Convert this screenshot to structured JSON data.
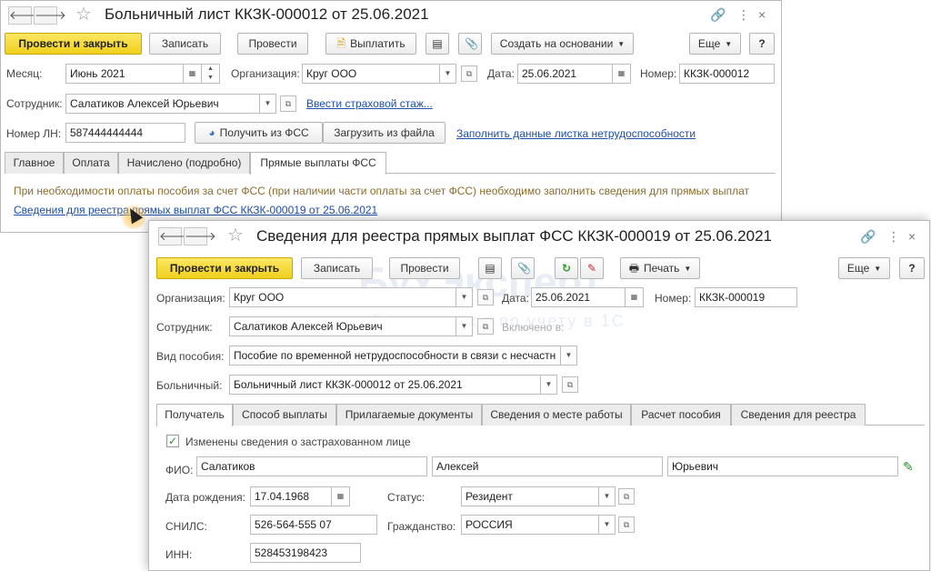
{
  "win1": {
    "title": "Больничный лист ККЗК-000012 от 25.06.2021",
    "nav_back": "🡐",
    "nav_forward": "🡒",
    "toolbar": {
      "post_close": "Провести и закрыть",
      "save": "Записать",
      "post": "Провести",
      "pay": "Выплатить",
      "create_based": "Создать на основании",
      "more": "Еще",
      "help": "?"
    },
    "form": {
      "month_label": "Месяц:",
      "month_value": "Июнь 2021",
      "org_label": "Организация:",
      "org_value": "Круг ООО",
      "date_label": "Дата:",
      "date_value": "25.06.2021",
      "number_label": "Номер:",
      "number_value": "ККЗК-000012",
      "employee_label": "Сотрудник:",
      "employee_value": "Салатиков Алексей Юрьевич",
      "insurance_link": "Ввести страховой стаж...",
      "ln_label": "Номер ЛН:",
      "ln_value": "587444444444",
      "get_fss": "Получить из ФСС",
      "load_file": "Загрузить из файла",
      "fill_link": "Заполнить данные листка нетрудоспособности"
    },
    "tabs": [
      "Главное",
      "Оплата",
      "Начислено (подробно)",
      "Прямые выплаты ФСС"
    ],
    "note": "При необходимости оплаты пособия за счет ФСС (при наличии части оплаты за счет ФСС) необходимо заполнить сведения для прямых выплат",
    "registry_link": "Сведения для реестра прямых выплат ФСС ККЗК-000019 от 25.06.2021"
  },
  "win2": {
    "title": "Сведения для реестра прямых выплат ФСС ККЗК-000019 от 25.06.2021",
    "toolbar": {
      "post_close": "Провести и закрыть",
      "save": "Записать",
      "post": "Провести",
      "print": "Печать",
      "more": "Еще",
      "help": "?"
    },
    "form": {
      "org_label": "Организация:",
      "org_value": "Круг ООО",
      "date_label": "Дата:",
      "date_value": "25.06.2021",
      "number_label": "Номер:",
      "number_value": "ККЗК-000019",
      "employee_label": "Сотрудник:",
      "employee_value": "Салатиков Алексей Юрьевич",
      "included_label": "Включено в:",
      "benefit_label": "Вид пособия:",
      "benefit_value": "Пособие по временной нетрудоспособности в связи с несчастн",
      "sick_label": "Больничный:",
      "sick_value": "Больничный лист ККЗК-000012 от 25.06.2021"
    },
    "tabs": [
      "Получатель",
      "Способ выплаты",
      "Прилагаемые документы",
      "Сведения о месте работы",
      "Расчет пособия",
      "Сведения для реестра"
    ],
    "recipient": {
      "changed_label": "Изменены сведения о застрахованном лице",
      "fio_label": "ФИО:",
      "last_name": "Салатиков",
      "first_name": "Алексей",
      "patronymic": "Юрьевич",
      "birth_label": "Дата рождения:",
      "birth_value": "17.04.1968",
      "status_label": "Статус:",
      "status_value": "Резидент",
      "snils_label": "СНИЛС:",
      "snils_value": "526-564-555 07",
      "citizenship_label": "Гражданство:",
      "citizenship_value": "РОССИЯ",
      "inn_label": "ИНН:",
      "inn_value": "528453198423"
    },
    "watermark_brand": "БухЭксперт",
    "watermark_sub": "База ответов по учету в 1С"
  }
}
